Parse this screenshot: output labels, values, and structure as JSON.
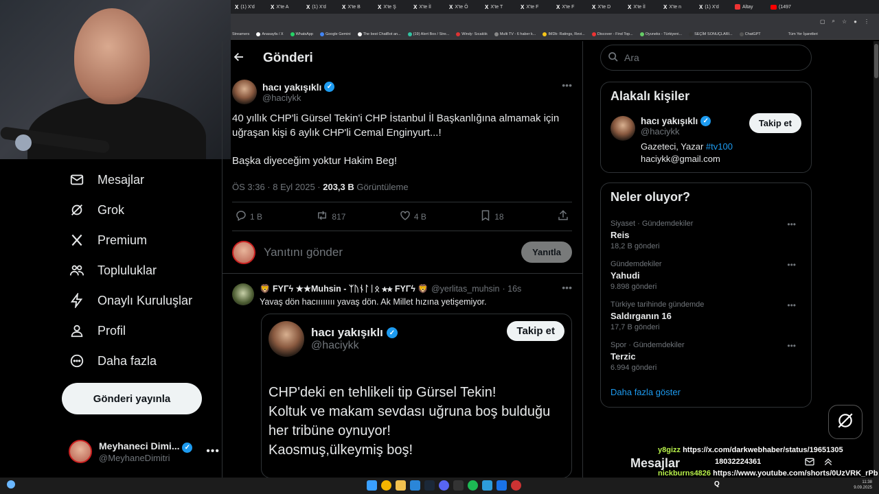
{
  "browser": {
    "tabs": [
      {
        "label": "(1) X'd"
      },
      {
        "label": "X'te A"
      },
      {
        "label": "(1) X'd"
      },
      {
        "label": "X'te B"
      },
      {
        "label": "X'te Ş"
      },
      {
        "label": "X'te İl"
      },
      {
        "label": "X'te Ö"
      },
      {
        "label": "X'te T"
      },
      {
        "label": "X'te F"
      },
      {
        "label": "X'te F"
      },
      {
        "label": "X'te D"
      },
      {
        "label": "X'te İl"
      },
      {
        "label": "X'te n"
      },
      {
        "label": "(1) X'd"
      },
      {
        "label": "Altay"
      },
      {
        "label": "(1497"
      }
    ],
    "bookmarks": [
      "Streamers",
      "Anasayfa / X",
      "WhatsApp",
      "Google Gemini",
      "The best ChatBot an...",
      "(19) Alert Box / Stre...",
      "Windy: Sıcaklık",
      "Multi TV - 6 haber k...",
      "IMDb: Ratings, Revi...",
      "Discover - Find Top...",
      "Oyuneks - Türkiyeni...",
      "SEÇİM SONUÇLARI...",
      "ChatGPT",
      "Tüm Yer İşaretleri"
    ]
  },
  "sidebar": {
    "items": [
      {
        "label": "Mesajlar",
        "icon": "mail-icon"
      },
      {
        "label": "Grok",
        "icon": "grok-icon"
      },
      {
        "label": "Premium",
        "icon": "x-logo-icon"
      },
      {
        "label": "Topluluklar",
        "icon": "communities-icon"
      },
      {
        "label": "Onaylı Kuruluşlar",
        "icon": "lightning-icon"
      },
      {
        "label": "Profil",
        "icon": "person-icon"
      },
      {
        "label": "Daha fazla",
        "icon": "more-circle-icon"
      }
    ],
    "post_button": "Gönderi yayınla",
    "account": {
      "name": "Meyhaneci Dimi...",
      "handle": "@MeyhaneDimitri"
    }
  },
  "main": {
    "header_title": "Gönderi",
    "tweet": {
      "name": "hacı yakışıklı",
      "handle": "@haciykk",
      "text1": "40 yıllık CHP'li Gürsel Tekin'i CHP İstanbul İl Başkanlığına almamak için uğraşan kişi 6 aylık CHP'li Cemal Enginyurt...!",
      "text2": "Başka diyeceğim yoktur Hakim Beg!",
      "time": "ÖS 3:36 · 8 Eyl 2025 · ",
      "views": "203,3 B",
      "views_label": " Görüntüleme",
      "replies": "1 B",
      "reposts": "817",
      "likes": "4 B",
      "bookmarks": "18"
    },
    "reply_placeholder": "Yanıtını gönder",
    "reply_button": "Yanıtla",
    "reply": {
      "name": "🦁 FYΓϟ ★★Muhsin - ᛉᚢᚾᛚᛁᛟ ★★ FYΓϟ 🦁",
      "handle": "@yerlitas_muhsin",
      "time": "· 16s",
      "text": "Yavaş dön hacıııııııı yavaş dön. Ak Millet hızına yetişemiyor."
    },
    "quote": {
      "name": "hacı yakışıklı",
      "handle": "@haciykk",
      "follow": "Takip et",
      "lines": [
        "CHP'deki en tehlikeli tip Gürsel Tekin!",
        "Koltuk ve makam sevdası uğruna boş bulduğu",
        "her tribüne oynuyor!",
        "Kaosmuş,ülkeymiş boş!"
      ]
    }
  },
  "right": {
    "search_placeholder": "Ara",
    "related": {
      "title": "Alakalı kişiler",
      "name": "hacı yakışıklı",
      "handle": "@haciykk",
      "follow": "Takip et",
      "bio_prefix": "Gazeteci, Yazar ",
      "bio_tag": "#tv100",
      "email": "haciykk@gmail.com"
    },
    "trends": {
      "title": "Neler oluyor?",
      "items": [
        {
          "context": "Siyaset · Gündemdekiler",
          "topic": "Reis",
          "count": "18,2 B gönderi"
        },
        {
          "context": "Gündemdekiler",
          "topic": "Yahudi",
          "count": "9.898 gönderi"
        },
        {
          "context": "Türkiye tarihinde gündemde",
          "topic": "Saldırganın 16",
          "count": "17,7 B gönderi"
        },
        {
          "context": "Spor · Gündemdekiler",
          "topic": "Terzic",
          "count": "6.994 gönderi"
        }
      ],
      "show_more": "Daha fazla göster"
    }
  },
  "dock": {
    "label": "Mesajlar"
  },
  "chat": [
    {
      "user": "y8gizz",
      "message": "https://x.com/darkwebhaber/status/19651305"
    },
    {
      "user": "",
      "message": "18032224361"
    },
    {
      "user": "nickburns4826",
      "message": "https://www.youtube.com/shorts/0UzVRK_rPb"
    }
  ],
  "taskbar": {
    "time": "11:38",
    "date": "9.09.2025",
    "q": "Q"
  },
  "colors": {
    "accent": "#1d9bf0",
    "background": "#000000",
    "border": "#2f3336",
    "muted": "#71767b"
  }
}
